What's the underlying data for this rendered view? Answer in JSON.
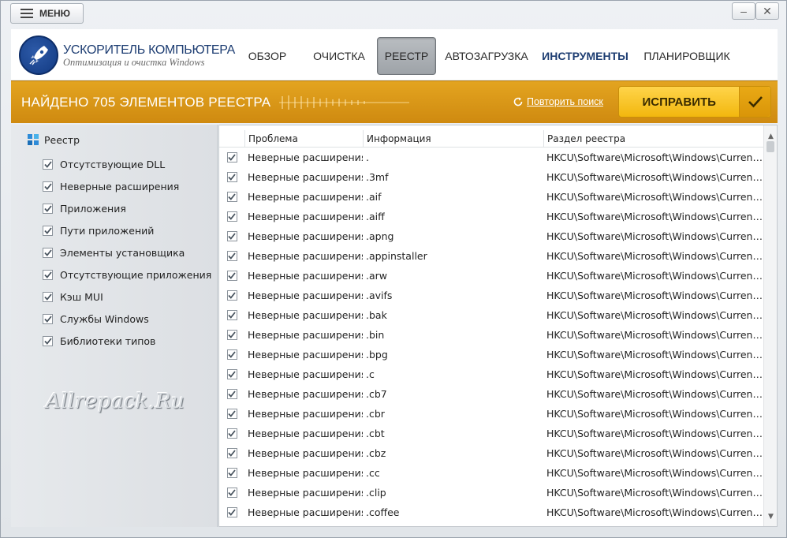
{
  "titlebar": {
    "menu_label": "МЕНЮ",
    "minimize": "–",
    "close": "✕"
  },
  "header": {
    "app_title": "УСКОРИТЕЛЬ КОМПЬЮТЕРА",
    "app_subtitle": "Оптимизация и очистка Windows",
    "nav": [
      {
        "label": "ОБЗОР"
      },
      {
        "label": "ОЧИСТКА"
      },
      {
        "label": "РЕЕСТР"
      },
      {
        "label": "АВТОЗАГРУЗКА"
      },
      {
        "label": "ИНСТРУМЕНТЫ"
      },
      {
        "label": "ПЛАНИРОВЩИК"
      }
    ],
    "active_tab": "РЕЕСТР"
  },
  "banner": {
    "title": "НАЙДЕНО 705 ЭЛЕМЕНТОВ РЕЕСТРА",
    "repeat_label": "Повторить поиск",
    "fix_label": "ИСПРАВИТЬ"
  },
  "sidebar": {
    "root_label": "Реестр",
    "items": [
      {
        "label": "Отсутствующие DLL",
        "checked": true
      },
      {
        "label": "Неверные расширения",
        "checked": true
      },
      {
        "label": "Приложения",
        "checked": true
      },
      {
        "label": "Пути приложений",
        "checked": true
      },
      {
        "label": "Элементы установщика",
        "checked": true
      },
      {
        "label": "Отсутствующие приложения",
        "checked": true
      },
      {
        "label": "Кэш MUI",
        "checked": true
      },
      {
        "label": "Службы Windows",
        "checked": true
      },
      {
        "label": "Библиотеки типов",
        "checked": true
      }
    ],
    "watermark": "Allrepack.Ru"
  },
  "table": {
    "columns": [
      "Проблема",
      "Информация",
      "Раздел реестра"
    ],
    "rows": [
      {
        "problem": "Неверные расширения",
        "info": ".",
        "section": "HKCU\\Software\\Microsoft\\Windows\\Current..."
      },
      {
        "problem": "Неверные расширения",
        "info": ".3mf",
        "section": "HKCU\\Software\\Microsoft\\Windows\\Current..."
      },
      {
        "problem": "Неверные расширения",
        "info": ".aif",
        "section": "HKCU\\Software\\Microsoft\\Windows\\Current..."
      },
      {
        "problem": "Неверные расширения",
        "info": ".aiff",
        "section": "HKCU\\Software\\Microsoft\\Windows\\Current..."
      },
      {
        "problem": "Неверные расширения",
        "info": ".apng",
        "section": "HKCU\\Software\\Microsoft\\Windows\\Current..."
      },
      {
        "problem": "Неверные расширения",
        "info": ".appinstaller",
        "section": "HKCU\\Software\\Microsoft\\Windows\\Current..."
      },
      {
        "problem": "Неверные расширения",
        "info": ".arw",
        "section": "HKCU\\Software\\Microsoft\\Windows\\Current..."
      },
      {
        "problem": "Неверные расширения",
        "info": ".avifs",
        "section": "HKCU\\Software\\Microsoft\\Windows\\Current..."
      },
      {
        "problem": "Неверные расширения",
        "info": ".bak",
        "section": "HKCU\\Software\\Microsoft\\Windows\\Current..."
      },
      {
        "problem": "Неверные расширения",
        "info": ".bin",
        "section": "HKCU\\Software\\Microsoft\\Windows\\Current..."
      },
      {
        "problem": "Неверные расширения",
        "info": ".bpg",
        "section": "HKCU\\Software\\Microsoft\\Windows\\Current..."
      },
      {
        "problem": "Неверные расширения",
        "info": ".c",
        "section": "HKCU\\Software\\Microsoft\\Windows\\Current..."
      },
      {
        "problem": "Неверные расширения",
        "info": ".cb7",
        "section": "HKCU\\Software\\Microsoft\\Windows\\Current..."
      },
      {
        "problem": "Неверные расширения",
        "info": ".cbr",
        "section": "HKCU\\Software\\Microsoft\\Windows\\Current..."
      },
      {
        "problem": "Неверные расширения",
        "info": ".cbt",
        "section": "HKCU\\Software\\Microsoft\\Windows\\Current..."
      },
      {
        "problem": "Неверные расширения",
        "info": ".cbz",
        "section": "HKCU\\Software\\Microsoft\\Windows\\Current..."
      },
      {
        "problem": "Неверные расширения",
        "info": ".cc",
        "section": "HKCU\\Software\\Microsoft\\Windows\\Current..."
      },
      {
        "problem": "Неверные расширения",
        "info": ".clip",
        "section": "HKCU\\Software\\Microsoft\\Windows\\Current..."
      },
      {
        "problem": "Неверные расширения",
        "info": ".coffee",
        "section": "HKCU\\Software\\Microsoft\\Windows\\Current..."
      }
    ]
  },
  "colors": {
    "banner": "#d99515",
    "fix_button": "#f7c31c",
    "brand_blue": "#1d3d72",
    "checkbox_check": "#4a5560"
  }
}
